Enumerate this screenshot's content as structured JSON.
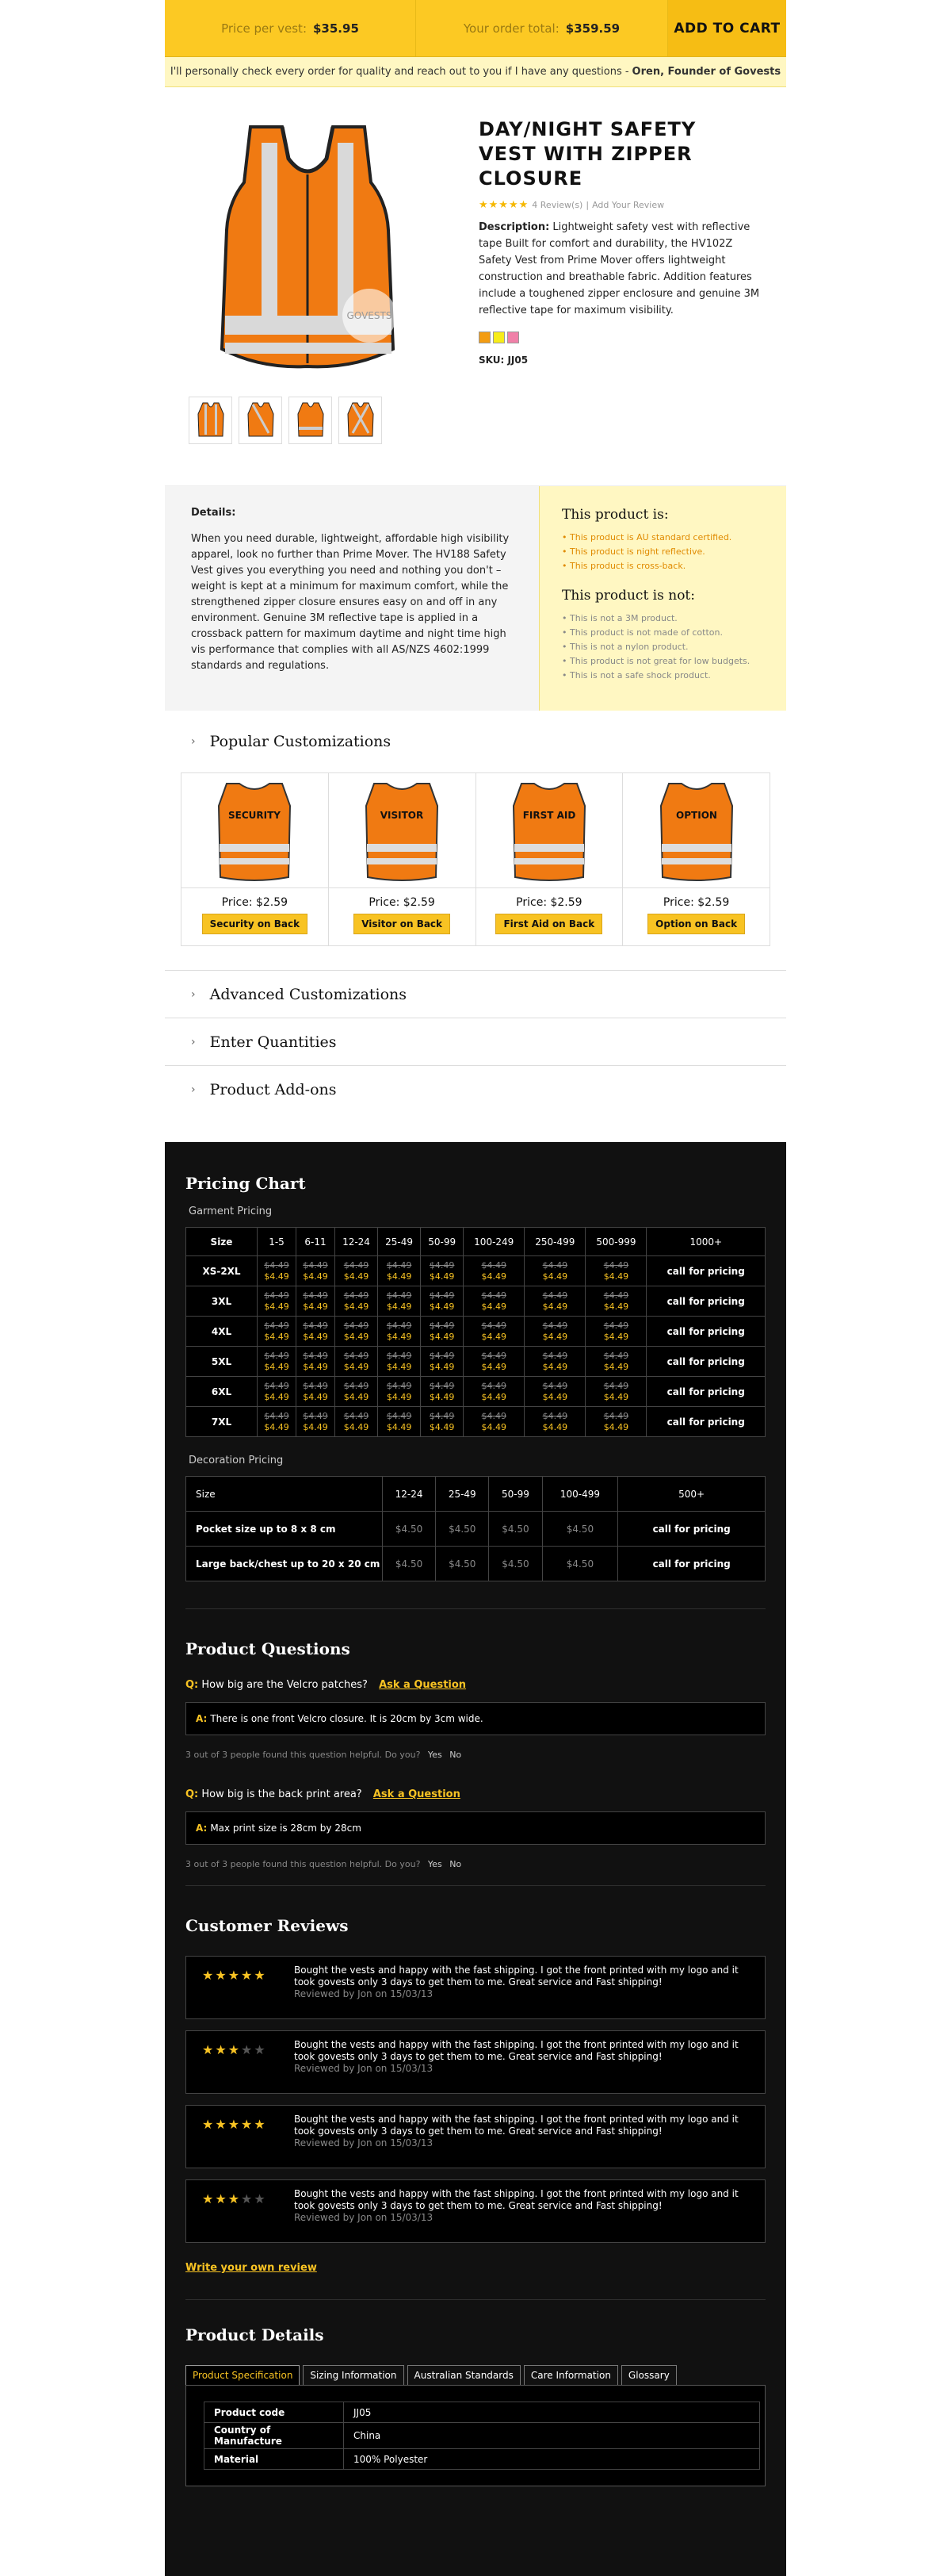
{
  "topbar": {
    "price_label": "Price per vest:",
    "price_value": "$35.95",
    "total_label": "Your order total:",
    "total_value": "$359.59",
    "cart_label": "ADD TO CART"
  },
  "notice": {
    "text": "I'll personally check every order for quality and reach out to you if I have any questions -",
    "signature": "Oren, Founder of Govests"
  },
  "product": {
    "title": "Day/Night Safety Vest with Zipper Closure",
    "stars": "★★★★★",
    "reviews": "4 Review(s)",
    "separator": "|",
    "add_review": "Add Your Review",
    "desc_label": "Description:",
    "desc": "Lightweight safety vest with reflective tape Built for comfort and durability, the HV102Z Safety Vest from Prime Mover offers lightweight construction and breathable fabric. Addition features include a toughened zipper enclosure and genuine 3M reflective tape for maximum visibility.",
    "sku_label": "SKU:",
    "sku": "JJ05",
    "swatches": [
      "#f39c12",
      "#f7ec1a",
      "#f080a8"
    ],
    "watermark": "GOVESTS"
  },
  "details": {
    "heading": "Details:",
    "text": "When you need durable, lightweight, affordable high visibility apparel, look no further than Prime Mover. The HV188 Safety Vest gives you everything you need and nothing you don't – weight is kept at a minimum for maximum comfort, while the strengthened zipper closure ensures easy on and off in any environment. Genuine 3M reflective tape is applied in a crossback pattern for maximum daytime and night time high vis performance that complies with all AS/NZS 4602:1999 standards and regulations.",
    "is_heading": "This product is:",
    "is_items": [
      "This product is AU standard certified.",
      "This product is night reflective.",
      "This product is cross-back."
    ],
    "isnot_heading": "This product is not:",
    "isnot_items": [
      "This is not a 3M product.",
      "This product is not made of cotton.",
      "This is not a nylon product.",
      "This product is not great for low budgets.",
      "This is not a safe shock product."
    ]
  },
  "popular": {
    "title": "Popular Customizations",
    "items": [
      {
        "print": "SECURITY",
        "price": "Price: $2.59",
        "button": "Security on Back"
      },
      {
        "print": "VISITOR",
        "price": "Price: $2.59",
        "button": "Visitor on Back"
      },
      {
        "print": "FIRST AID",
        "price": "Price: $2.59",
        "button": "First Aid on Back"
      },
      {
        "print": "OPTION",
        "price": "Price: $2.59",
        "button": "Option on Back"
      }
    ]
  },
  "accordions": {
    "advanced": "Advanced Customizations",
    "quantities": "Enter Quantities",
    "addons": "Product Add-ons"
  },
  "pricing": {
    "title": "Pricing Chart",
    "garment_label": "Garment Pricing",
    "headers": [
      "Size",
      "1-5",
      "6-11",
      "12-24",
      "25-49",
      "50-99",
      "100-249",
      "250-499",
      "500-999",
      "1000+"
    ],
    "sizes": [
      "XS-2XL",
      "3XL",
      "4XL",
      "5XL",
      "6XL",
      "7XL"
    ],
    "old_price": "$4.49",
    "new_price": "$4.49",
    "call": "call for pricing",
    "decoration_label": "Decoration Pricing",
    "dec_headers": [
      "Size",
      "12-24",
      "25-49",
      "50-99",
      "100-499",
      "500+"
    ],
    "dec_rows": [
      {
        "label": "Pocket size up to 8 x 8 cm",
        "values": [
          "$4.50",
          "$4.50",
          "$4.50",
          "$4.50"
        ],
        "last": "call for pricing"
      },
      {
        "label": "Large back/chest up to 20 x 20 cm",
        "values": [
          "$4.50",
          "$4.50",
          "$4.50",
          "$4.50"
        ],
        "last": "call for pricing"
      }
    ]
  },
  "questions": {
    "title": "Product Questions",
    "q_mark": "Q:",
    "a_mark": "A:",
    "ask": "Ask a Question",
    "items": [
      {
        "q": "How big are the Velcro patches?",
        "a": "There is one front Velcro closure. It is 20cm by 3cm wide.",
        "help": "3 out of 3 people found this question helpful. Do you?",
        "yes": "Yes",
        "no": "No"
      },
      {
        "q": "How big is the back print area?",
        "a": "Max print size is 28cm by 28cm",
        "help": "3 out of 3 people found this question helpful. Do you?",
        "yes": "Yes",
        "no": "No"
      }
    ]
  },
  "reviews": {
    "title": "Customer Reviews",
    "items": [
      {
        "rating": 5,
        "text": "Bought the vests and happy with the fast shipping. I got the front printed with my logo and it took govests only 3 days to get them to me. Great service and Fast shipping!",
        "by": "Reviewed by Jon on 15/03/13"
      },
      {
        "rating": 3,
        "text": "Bought the vests and happy with the fast shipping. I got the front printed with my logo and it took govests only 3 days to get them to me. Great service and Fast shipping!",
        "by": "Reviewed by Jon on 15/03/13"
      },
      {
        "rating": 5,
        "text": "Bought the vests and happy with the fast shipping. I got the front printed with my logo and it took govests only 3 days to get them to me. Great service and Fast shipping!",
        "by": "Reviewed by Jon on 15/03/13"
      },
      {
        "rating": 3,
        "text": "Bought the vests and happy with the fast shipping. I got the front printed with my logo and it took govests only 3 days to get them to me. Great service and Fast shipping!",
        "by": "Reviewed by Jon on 15/03/13"
      }
    ],
    "write": "Write your own review"
  },
  "product_details": {
    "title": "Product Details",
    "tabs": [
      "Product Specification",
      "Sizing Information",
      "Australian Standards",
      "Care Information",
      "Glossary"
    ],
    "specs": [
      {
        "k": "Product code",
        "v": "JJ05"
      },
      {
        "k": "Country of Manufacture",
        "v": "China"
      },
      {
        "k": "Material",
        "v": "100% Polyester"
      }
    ]
  }
}
